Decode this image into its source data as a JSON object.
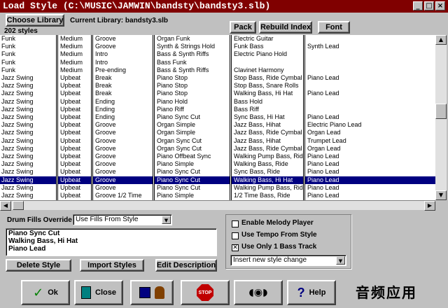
{
  "window": {
    "title": "Load Style (C:\\MUSIC\\JAMWIN\\bandsty\\bandsty3.slb)",
    "btn_min": "_",
    "btn_max": "□",
    "btn_close": "×"
  },
  "toolbar": {
    "choose_library": "Choose Library",
    "current_library": "Current Library: bandsty3.slb",
    "style_count": "202 styles",
    "pack": "Pack",
    "rebuild_index": "Rebuild Index",
    "font": "Font"
  },
  "grid": {
    "rows": [
      [
        "Funk",
        "Medium",
        "Groove",
        "Organ Funk",
        "Electric Guitar",
        ""
      ],
      [
        "Funk",
        "Medium",
        "Groove",
        "Synth & Strings Hold",
        "Funk Bass",
        "Synth Lead"
      ],
      [
        "Funk",
        "Medium",
        "Intro",
        "Bass & Synth Riffs",
        "Electric Piano Hold",
        ""
      ],
      [
        "Funk",
        "Medium",
        "Intro",
        "Bass Funk",
        "",
        ""
      ],
      [
        "Funk",
        "Medium",
        "Pre-ending",
        "Bass & Synth Riffs",
        "Clavinet Harmony",
        ""
      ],
      [
        "Jazz Swing",
        "Upbeat",
        "Break",
        "Piano Stop",
        "Stop Bass, Ride Cymbal",
        "Piano Lead"
      ],
      [
        "Jazz Swing",
        "Upbeat",
        "Break",
        "Piano Stop",
        "Stop Bass, Snare Rolls",
        ""
      ],
      [
        "Jazz Swing",
        "Upbeat",
        "Break",
        "Piano Stop",
        "Walking Bass, Hi Hat",
        "Piano Lead"
      ],
      [
        "Jazz Swing",
        "Upbeat",
        "Ending",
        "Piano Hold",
        "Bass Hold",
        ""
      ],
      [
        "Jazz Swing",
        "Upbeat",
        "Ending",
        "Piano Riff",
        "Bass Riff",
        ""
      ],
      [
        "Jazz Swing",
        "Upbeat",
        "Ending",
        "Piano Sync Cut",
        "Sync Bass, Hi Hat",
        "Piano Lead"
      ],
      [
        "Jazz Swing",
        "Upbeat",
        "Groove",
        "Organ Simple",
        "Jazz Bass, Hihat",
        "Electric Piano Lead"
      ],
      [
        "Jazz Swing",
        "Upbeat",
        "Groove",
        "Organ Simple",
        "Jazz Bass, Ride Cymbal",
        "Organ Lead"
      ],
      [
        "Jazz Swing",
        "Upbeat",
        "Groove",
        "Organ Sync Cut",
        "Jazz Bass, Hihat",
        "Trumpet Lead"
      ],
      [
        "Jazz Swing",
        "Upbeat",
        "Groove",
        "Organ Sync Cut",
        "Jazz Bass, Ride Cymbal",
        "Organ Lead"
      ],
      [
        "Jazz Swing",
        "Upbeat",
        "Groove",
        "Piano Offbeat Sync",
        "Walking Pump Bass, Ride",
        "Piano Lead"
      ],
      [
        "Jazz Swing",
        "Upbeat",
        "Groove",
        "Piano Simple",
        "Walking Bass, Ride",
        "Piano Lead"
      ],
      [
        "Jazz Swing",
        "Upbeat",
        "Groove",
        "Piano Sync Cut",
        "Sync Bass, Ride",
        "Piano Lead"
      ],
      [
        "Jazz Swing",
        "Upbeat",
        "Groove",
        "Piano Sync Cut",
        "Walking Bass, Hi Hat",
        "Piano Lead"
      ],
      [
        "Jazz Swing",
        "Upbeat",
        "Groove",
        "Piano Sync Cut",
        "Walking Pump Bass, Ride",
        "Piano Lead"
      ],
      [
        "Jazz Swing",
        "Upbeat",
        "Groove 1/2 Time",
        "Piano Simple",
        "1/2 Time Bass, Ride",
        "Piano Lead"
      ]
    ]
  },
  "options": {
    "drum_fills_label": "Drum Fills Override",
    "drum_fills_value": "Use Fills From Style",
    "tracks": [
      "Piano Sync Cut",
      "Walking Bass, Hi Hat",
      "Piano Lead"
    ],
    "delete_style": "Delete Style",
    "import_styles": "Import Styles",
    "edit_description": "Edit Description",
    "enable_melody": "Enable Melody Player",
    "use_tempo": "Use Tempo From Style",
    "use_one_bass": "Use Only 1 Bass Track",
    "insert_change": "Insert new style change",
    "check_mark": "✕"
  },
  "footer": {
    "ok": "Ok",
    "close": "Close",
    "stop": "STOP",
    "help": "Help",
    "watermark": "音频应用"
  }
}
